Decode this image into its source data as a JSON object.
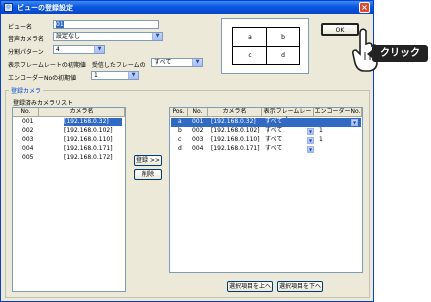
{
  "window": {
    "title": "ビューの登録設定",
    "close_glyph": "×"
  },
  "form": {
    "view_name_label": "ビュー名",
    "view_name_value": "01",
    "audio_camera_label": "音声カメラ名",
    "audio_camera_value": "設定なし",
    "split_pattern_label": "分割パターン",
    "split_pattern_value": "4",
    "frame_rate_label": "表示フレームレートの初期値　受信したフレームの",
    "frame_rate_value": "すべて",
    "encoder_label": "エンコーダーNoの初期値",
    "encoder_value": "1"
  },
  "preview": {
    "quadrants": [
      "a",
      "b",
      "c",
      "d"
    ]
  },
  "ok_button": "OK",
  "callout": {
    "text": "クリック"
  },
  "group": {
    "title": "登録カメラ",
    "registered_list_label": "登録済みカメラリスト",
    "left_columns": [
      "No.",
      "カメラ名"
    ],
    "left_rows": [
      {
        "no": "001",
        "name": "[192.168.0.32]",
        "selected": true
      },
      {
        "no": "002",
        "name": "[192.168.0.102]"
      },
      {
        "no": "003",
        "name": "[192.168.0.110]"
      },
      {
        "no": "004",
        "name": "[192.168.0.171]"
      },
      {
        "no": "005",
        "name": "[192.168.0.172]"
      }
    ],
    "register_button": "登録 >>",
    "delete_button": "削除",
    "right_columns": [
      "Pos.",
      "No.",
      "カメラ名",
      "表示フレームレート",
      "エンコーダーNo."
    ],
    "right_rows": [
      {
        "pos": "a",
        "no": "001",
        "name": "[192.168.0.32]",
        "rate": "すべて",
        "enc": ""
      },
      {
        "pos": "b",
        "no": "002",
        "name": "[192.168.0.102]",
        "rate": "すべて",
        "enc": "1"
      },
      {
        "pos": "c",
        "no": "003",
        "name": "[192.168.0.110]",
        "rate": "すべて",
        "enc": "1"
      },
      {
        "pos": "d",
        "no": "004",
        "name": "[192.168.0.171]",
        "rate": "すべて",
        "enc": ""
      }
    ],
    "move_up_button": "選択項目を上へ",
    "move_down_button": "選択項目を下へ"
  },
  "icons": {
    "dropdown": "▼"
  },
  "colors": {
    "selection": "#316ac5",
    "title_bar": "#0a58e0",
    "callout": "#222222"
  }
}
